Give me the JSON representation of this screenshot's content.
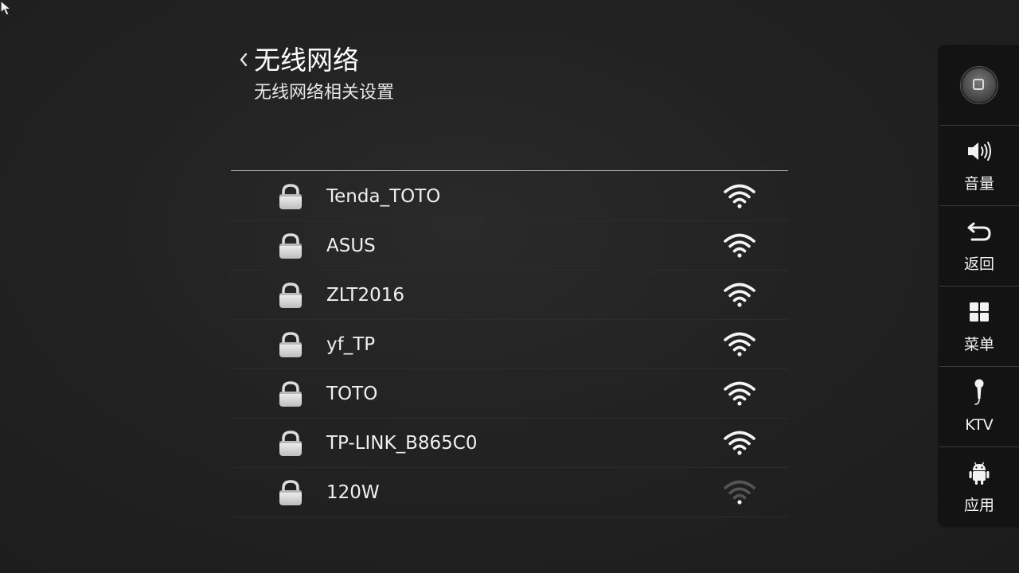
{
  "cursor": {
    "icon": "mouse-pointer-icon"
  },
  "header": {
    "back_icon": "chevron-left-icon",
    "title": "无线网络",
    "subtitle": "无线网络相关设置"
  },
  "networks": [
    {
      "ssid": "Tenda_TOTO",
      "locked": true,
      "signal": 4
    },
    {
      "ssid": "ASUS",
      "locked": true,
      "signal": 4
    },
    {
      "ssid": "ZLT2016",
      "locked": true,
      "signal": 4
    },
    {
      "ssid": "yf_TP",
      "locked": true,
      "signal": 4
    },
    {
      "ssid": "TOTO",
      "locked": true,
      "signal": 4
    },
    {
      "ssid": "TP-LINK_B865C0",
      "locked": true,
      "signal": 4
    },
    {
      "ssid": "120W",
      "locked": true,
      "signal": 1
    }
  ],
  "dock": {
    "home_icon": "home-icon",
    "items": [
      {
        "key": "volume",
        "label": "音量",
        "icon": "volume-icon"
      },
      {
        "key": "back",
        "label": "返回",
        "icon": "return-arrow-icon"
      },
      {
        "key": "menu",
        "label": "菜单",
        "icon": "grid-menu-icon"
      },
      {
        "key": "ktv",
        "label": "KTV",
        "icon": "microphone-icon"
      },
      {
        "key": "apps",
        "label": "应用",
        "icon": "android-icon"
      }
    ]
  },
  "colors": {
    "background": "#222222",
    "dock_background": "#131313",
    "text": "#f2f2f2",
    "divider": "#bdbdbd",
    "signal_active": "#f5f5f5",
    "signal_inactive": "#555555"
  }
}
